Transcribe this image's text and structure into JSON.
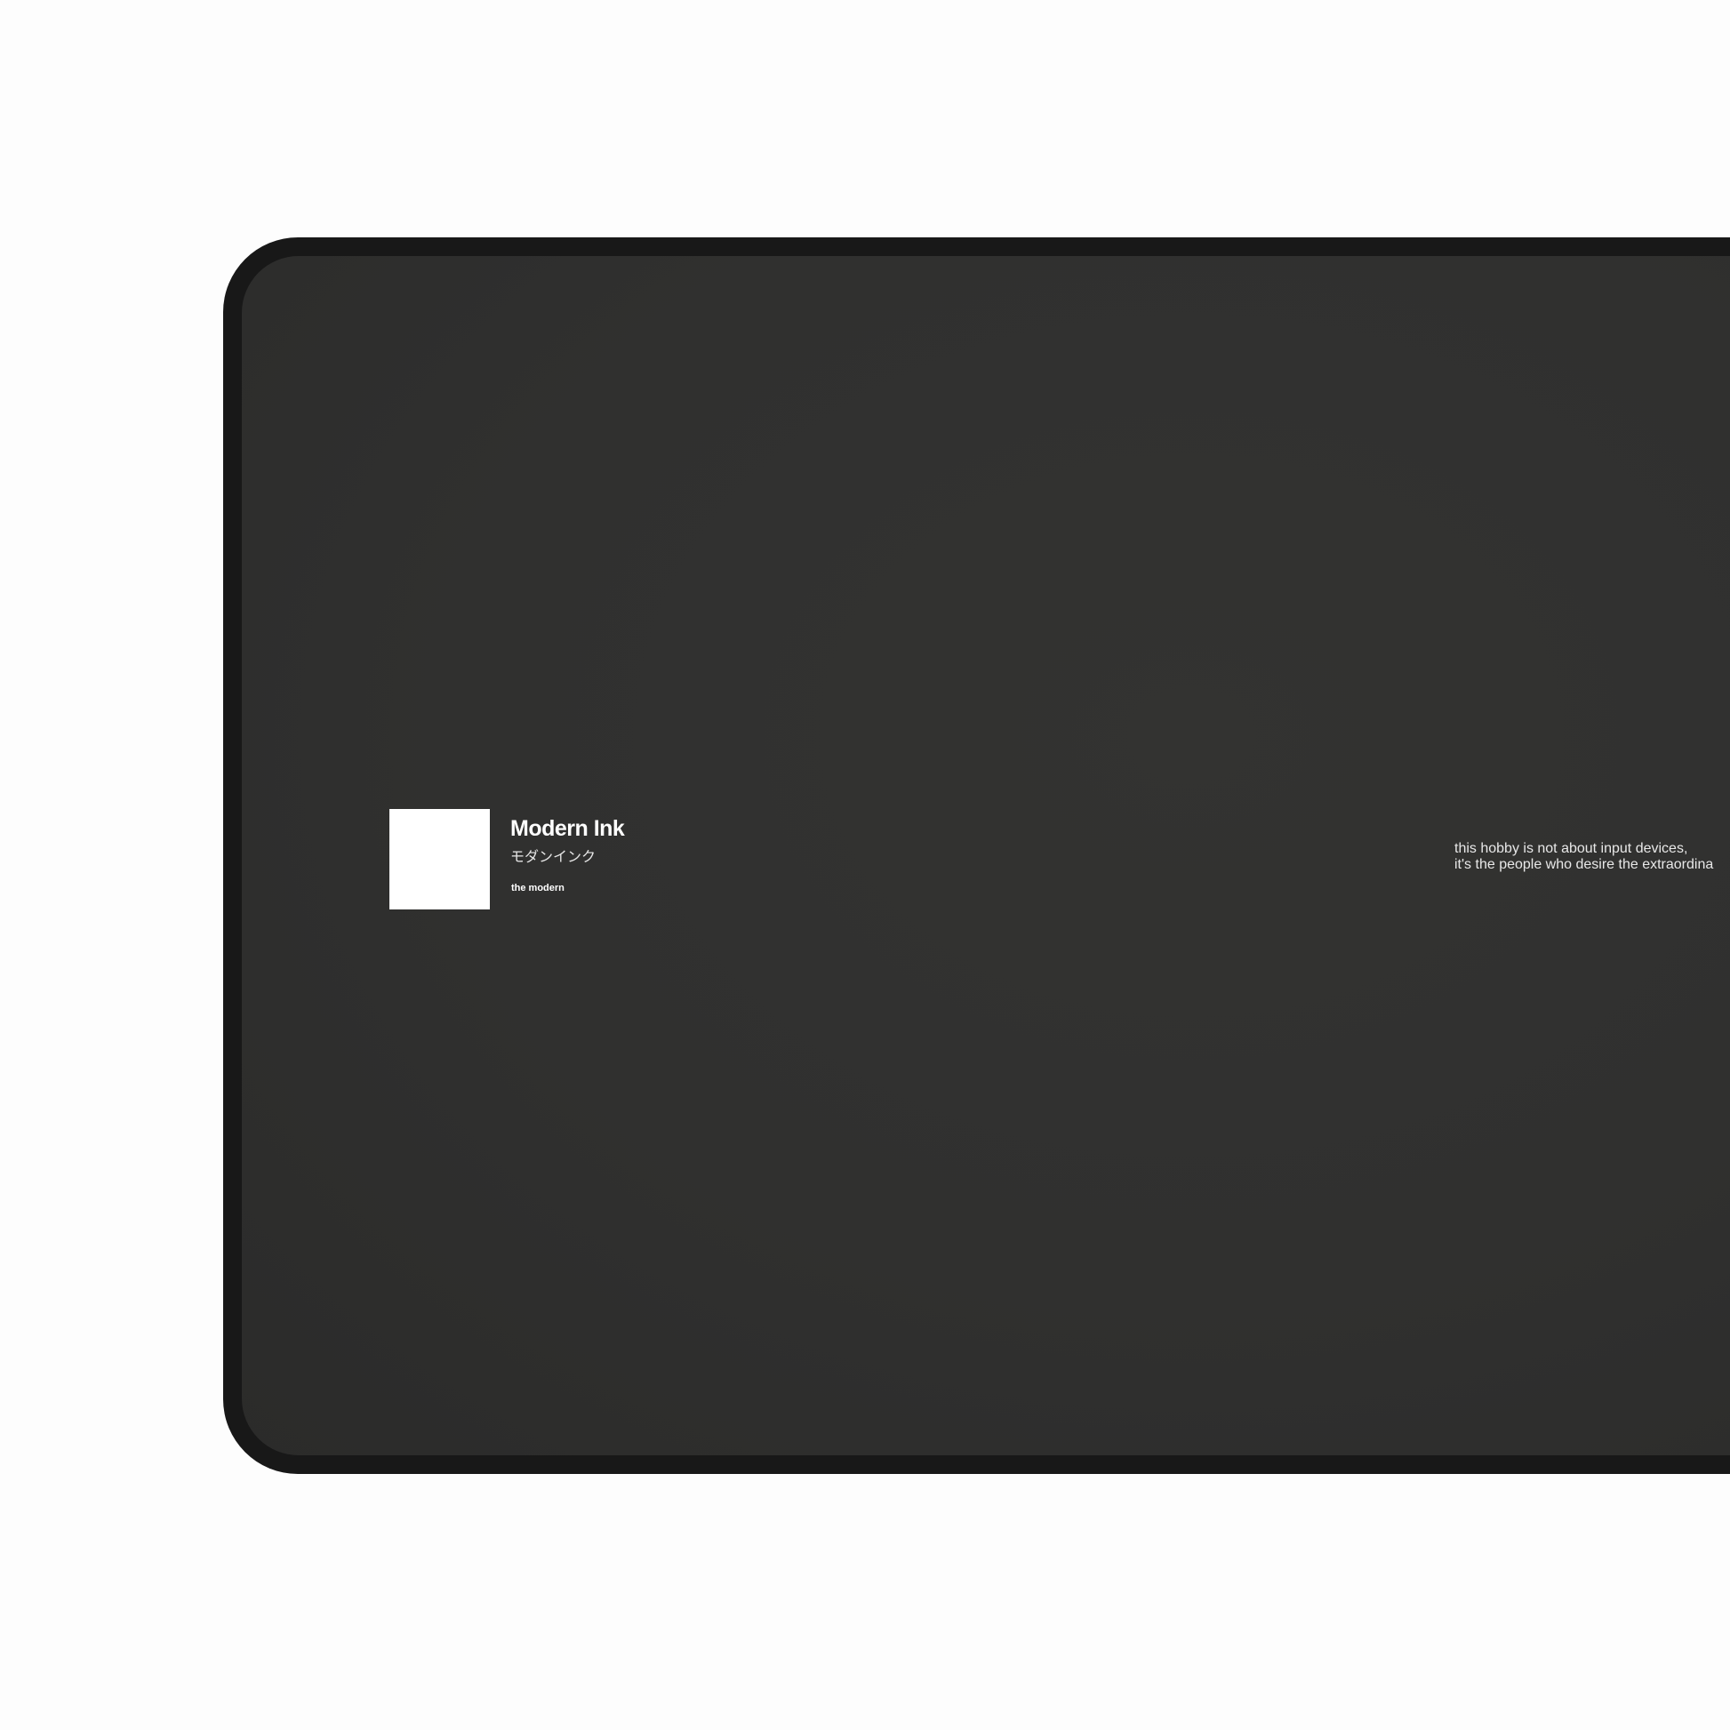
{
  "brand": {
    "name": "Modern Ink",
    "name_jp": "モダンインク",
    "tagline": "the modern"
  },
  "slogan": {
    "line1": "this hobby is not about input devices,",
    "line2": "it's the people who desire the extraordina"
  },
  "colors": {
    "background": "#fdfdfd",
    "mat_edge": "#181818",
    "mat_surface": "#30302f",
    "logo": "#ffffff"
  }
}
